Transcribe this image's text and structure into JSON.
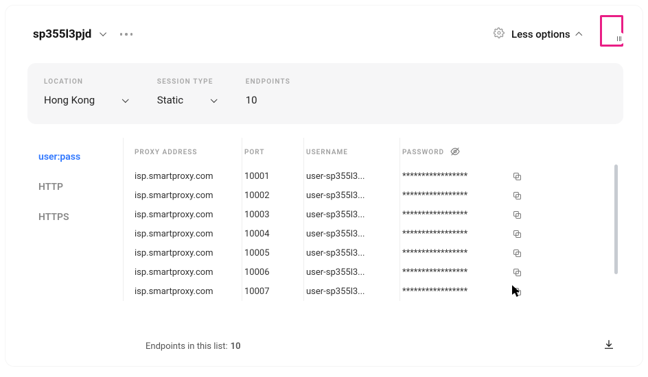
{
  "header": {
    "instance_name": "sp355l3pjd",
    "less_options": "Less options"
  },
  "controls": {
    "location": {
      "label": "LOCATION",
      "value": "Hong Kong"
    },
    "session_type": {
      "label": "SESSION TYPE",
      "value": "Static"
    },
    "endpoints": {
      "label": "ENDPOINTS",
      "value": "10"
    }
  },
  "tabs": [
    {
      "key": "userpass",
      "label": "user:pass",
      "active": true
    },
    {
      "key": "http",
      "label": "HTTP",
      "active": false
    },
    {
      "key": "https",
      "label": "HTTPS",
      "active": false
    }
  ],
  "table": {
    "headers": {
      "proxy_address": "PROXY ADDRESS",
      "port": "PORT",
      "username": "USERNAME",
      "password": "PASSWORD"
    },
    "password_mask": "*****************",
    "rows": [
      {
        "proxy": "isp.smartproxy.com",
        "port": "10001",
        "user": "user-sp355l3..."
      },
      {
        "proxy": "isp.smartproxy.com",
        "port": "10002",
        "user": "user-sp355l3..."
      },
      {
        "proxy": "isp.smartproxy.com",
        "port": "10003",
        "user": "user-sp355l3..."
      },
      {
        "proxy": "isp.smartproxy.com",
        "port": "10004",
        "user": "user-sp355l3..."
      },
      {
        "proxy": "isp.smartproxy.com",
        "port": "10005",
        "user": "user-sp355l3..."
      },
      {
        "proxy": "isp.smartproxy.com",
        "port": "10006",
        "user": "user-sp355l3..."
      },
      {
        "proxy": "isp.smartproxy.com",
        "port": "10007",
        "user": "user-sp355l3..."
      }
    ]
  },
  "footer": {
    "label": "Endpoints in this list:",
    "count": "10"
  }
}
